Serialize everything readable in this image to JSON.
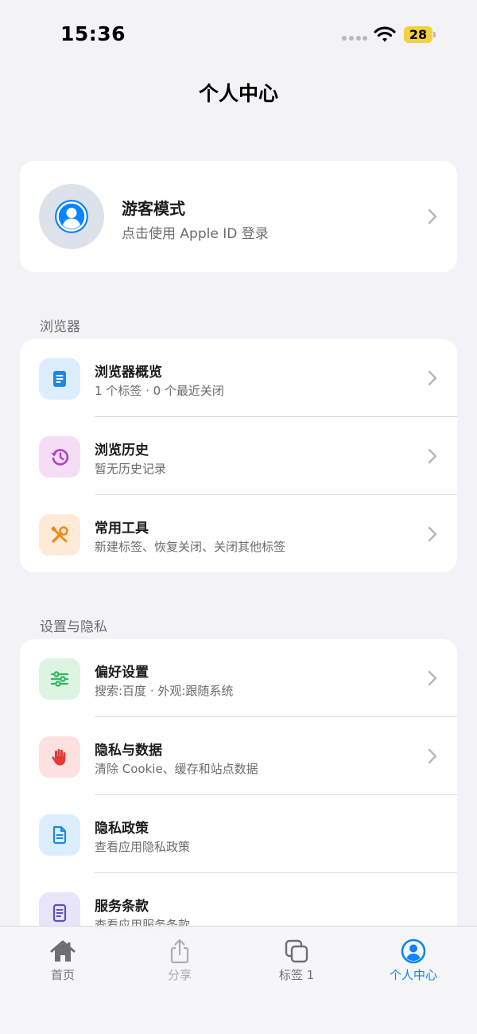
{
  "status_bar": {
    "time": "15:36",
    "battery": "28"
  },
  "nav": {
    "title": "个人中心"
  },
  "profile": {
    "name": "游客模式",
    "subtitle": "点击使用 Apple ID 登录"
  },
  "sections": {
    "browser": {
      "label": "浏览器",
      "rows": [
        {
          "title": "浏览器概览",
          "subtitle": "1 个标签 · 0 个最近关闭",
          "icon": "document-icon"
        },
        {
          "title": "浏览历史",
          "subtitle": "暂无历史记录",
          "icon": "history-clock-icon"
        },
        {
          "title": "常用工具",
          "subtitle": "新建标签、恢复关闭、关闭其他标签",
          "icon": "tools-icon"
        }
      ]
    },
    "settings": {
      "label": "设置与隐私",
      "rows": [
        {
          "title": "偏好设置",
          "subtitle": "搜索:百度 · 外观:跟随系统",
          "icon": "sliders-icon"
        },
        {
          "title": "隐私与数据",
          "subtitle": "清除 Cookie、缓存和站点数据",
          "icon": "hand-stop-icon"
        },
        {
          "title": "隐私政策",
          "subtitle": "查看应用隐私政策",
          "icon": "policy-document-icon"
        },
        {
          "title": "服务条款",
          "subtitle": "查看应用服务条款",
          "icon": "terms-document-icon"
        }
      ]
    }
  },
  "tab_bar": {
    "tabs": [
      {
        "label": "首页",
        "icon": "home-icon"
      },
      {
        "label": "分享",
        "icon": "share-icon"
      },
      {
        "label": "标签 1",
        "icon": "tabs-icon"
      },
      {
        "label": "个人中心",
        "icon": "profile-icon"
      }
    ]
  },
  "colors": {
    "accent": "#0A84FF",
    "background": "#F2F2F7",
    "card": "#FFFFFF",
    "battery": "#F4D03F"
  }
}
